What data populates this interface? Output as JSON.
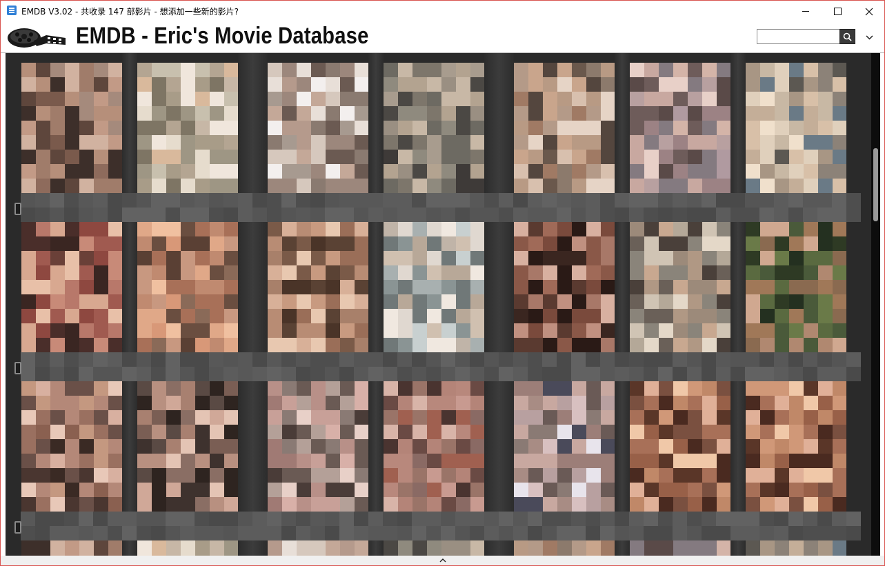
{
  "window": {
    "title": "EMDB V3.02 - 共收录 147 部影片 - 想添加一些新的影片?",
    "controls": {
      "minimize": "minimize-icon",
      "maximize": "maximize-icon",
      "close": "close-icon"
    }
  },
  "header": {
    "app_title": "EMDB - Eric's Movie Database",
    "logo_icon": "film-reel-icon",
    "search": {
      "value": "",
      "placeholder": "",
      "button_icon": "search-icon"
    },
    "menu_icon": "chevron-down-icon"
  },
  "library": {
    "rows_visible": 3,
    "columns": 7,
    "posters_blurred": true,
    "poster_palettes": [
      [
        "#7a5a4c",
        "#a07c6a",
        "#c29a86",
        "#5e463c",
        "#b68f7a",
        "#8e6b5c",
        "#d1b2a0",
        "#3d2f2a",
        "#a58a7c"
      ],
      [
        "#9e9684",
        "#c8c0ae",
        "#e6dccd",
        "#b4a592",
        "#7e7564",
        "#d9b99c",
        "#f0e6dc",
        "#a89c88",
        "#c7b7a6"
      ],
      [
        "#a79a90",
        "#d6c8bd",
        "#8a7a70",
        "#e8dfd8",
        "#b59a8c",
        "#6b5a52",
        "#f3efee",
        "#c4a898",
        "#9c877c"
      ],
      [
        "#6d6a62",
        "#8f8a7e",
        "#a89c8e",
        "#4b4844",
        "#b3a390",
        "#7d766b",
        "#c8b8a6",
        "#3e3a38",
        "#9a8f82"
      ],
      [
        "#8c7a6c",
        "#b89a84",
        "#d8c0ae",
        "#6a584c",
        "#c9a58c",
        "#a07a64",
        "#e6d4c6",
        "#54463e",
        "#b49a88"
      ],
      [
        "#847a80",
        "#b09aa0",
        "#c8a8a0",
        "#6e5c5a",
        "#d4b4a8",
        "#9c8284",
        "#e8d0c8",
        "#5a4a48",
        "#b8a0a0"
      ],
      [
        "#8c8278",
        "#c8b8a4",
        "#e0d0bc",
        "#6a7a86",
        "#d8c0a8",
        "#a89684",
        "#f0e0cc",
        "#5c5852",
        "#c4ae98"
      ],
      [
        "#6a4038",
        "#a05a50",
        "#c88a78",
        "#4a2e2a",
        "#d8a890",
        "#8e4840",
        "#e8c0a8",
        "#3a2622",
        "#b8786a"
      ],
      [
        "#8a6a58",
        "#c08a70",
        "#e0a888",
        "#6a4e40",
        "#d89878",
        "#a87058",
        "#f0c0a0",
        "#5a4034",
        "#c89880"
      ],
      [
        "#7a5a48",
        "#a8806a",
        "#c89a80",
        "#5a4234",
        "#d8b098",
        "#9a6e58",
        "#e8c8b0",
        "#4a3428",
        "#b88c74"
      ],
      [
        "#a8b0b0",
        "#c8d0d0",
        "#e0d8d0",
        "#8a9494",
        "#d0c0b0",
        "#b8a898",
        "#f0e8e0",
        "#707878",
        "#c0b4a8"
      ],
      [
        "#5a3a30",
        "#7a4a3c",
        "#a06a58",
        "#3a2620",
        "#c09080",
        "#8a5848",
        "#d8b0a0",
        "#2a1a16",
        "#a87868"
      ],
      [
        "#8a847a",
        "#b4a898",
        "#d0c4b4",
        "#6a6058",
        "#c8a890",
        "#9c8a7a",
        "#e4d8c8",
        "#4a403a",
        "#b09884"
      ],
      [
        "#4a5a3a",
        "#6a7a48",
        "#8a6a50",
        "#2e3a24",
        "#b08870",
        "#5a6a40",
        "#d0a890",
        "#243020",
        "#a07858"
      ],
      [
        "#6a5048",
        "#9a7060",
        "#c49880",
        "#4a3630",
        "#d8b0a0",
        "#8a6050",
        "#e8c8b8",
        "#3a2a24",
        "#b48878"
      ],
      [
        "#5a4a44",
        "#8a6e64",
        "#b89080",
        "#3e322e",
        "#d0a898",
        "#7a5e54",
        "#e4c4b4",
        "#2e2420",
        "#a88070"
      ],
      [
        "#8a7a74",
        "#b4a098",
        "#c8a098",
        "#6a5a54",
        "#d8b0a8",
        "#a07a74",
        "#e8d0c8",
        "#4a3c38",
        "#b89088"
      ],
      [
        "#8a6a64",
        "#b48478",
        "#c89a90",
        "#6a4a44",
        "#a06050",
        "#9a7468",
        "#d8b4a8",
        "#4a3430",
        "#b8887c"
      ],
      [
        "#8a7a74",
        "#a88c84",
        "#c8a8a0",
        "#6a5a56",
        "#d8c0c0",
        "#9c7e78",
        "#e8e4ec",
        "#4a4a5a",
        "#b8a0a0"
      ],
      [
        "#7a5040",
        "#a87058",
        "#d09878",
        "#5a3628",
        "#e0b098",
        "#986048",
        "#f0c8a8",
        "#4a2a20",
        "#c08868"
      ],
      [
        "#7a5040",
        "#a87058",
        "#d09878",
        "#5a3628",
        "#e0b098",
        "#986048",
        "#f0c8a8",
        "#4a2a20",
        "#c08868"
      ]
    ]
  }
}
